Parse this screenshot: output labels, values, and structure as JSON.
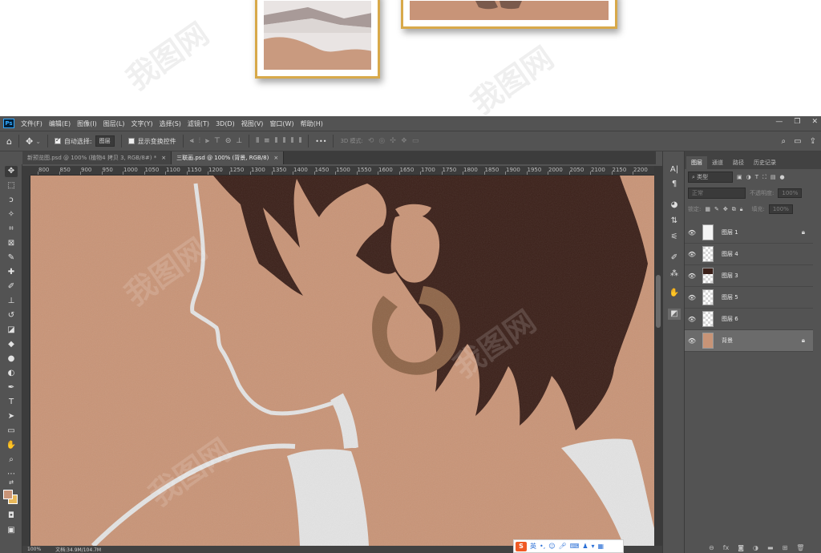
{
  "preview": {
    "watermark": "我图网"
  },
  "menubar": {
    "items": [
      "文件(F)",
      "编辑(E)",
      "图像(I)",
      "图层(L)",
      "文字(Y)",
      "选择(S)",
      "滤镜(T)",
      "3D(D)",
      "视图(V)",
      "窗口(W)",
      "帮助(H)"
    ],
    "minimize": "—",
    "restore": "❐",
    "close": "✕"
  },
  "options": {
    "auto_select_label": "自动选择:",
    "auto_select_value": "图层",
    "transform_label": "显示变换控件",
    "more": "•••",
    "mode3d_label": "3D 模式:"
  },
  "tabs": [
    {
      "label": "新预览图.psd @ 100% (植物4 拷贝 3, RGB/8#) *",
      "close": "×"
    },
    {
      "label": "三联画.psd @ 100% (背景, RGB/8)",
      "close": "×"
    }
  ],
  "ruler": {
    "h_ticks": [
      "800",
      "850",
      "900",
      "950",
      "1000",
      "1050",
      "1100",
      "1150",
      "1200",
      "1250",
      "1300",
      "1350",
      "1400",
      "1450",
      "1500",
      "1550",
      "1600",
      "1650",
      "1700",
      "1750",
      "1800",
      "1850",
      "1900",
      "1950",
      "2000",
      "2050",
      "2100",
      "2150",
      "2200"
    ]
  },
  "status": {
    "zoom": "100%",
    "doc": "文档:34.9M/104.7M"
  },
  "ime": {
    "logo": "S",
    "lang": "英"
  },
  "layers_panel": {
    "tabs": [
      "图层",
      "通道",
      "路径",
      "历史记录"
    ],
    "filter_label": "类型",
    "blend_mode": "正常",
    "opacity_label": "不透明度:",
    "opacity_value": "100%",
    "lock_label": "锁定:",
    "fill_label": "填充:",
    "fill_value": "100%",
    "layers": [
      {
        "name": "图层 1",
        "locked": true
      },
      {
        "name": "图层 4",
        "locked": false
      },
      {
        "name": "图层 3",
        "locked": false
      },
      {
        "name": "图层 5",
        "locked": false
      },
      {
        "name": "图层 6",
        "locked": false
      },
      {
        "name": "背景",
        "locked": true
      }
    ]
  },
  "colors": {
    "canvas": "#c89477",
    "hair": "#3b2019",
    "earring": "#8e6548",
    "line": "#e3e3e3",
    "fg_swatch": "#c89478",
    "bg_swatch": "#e8b85a"
  }
}
